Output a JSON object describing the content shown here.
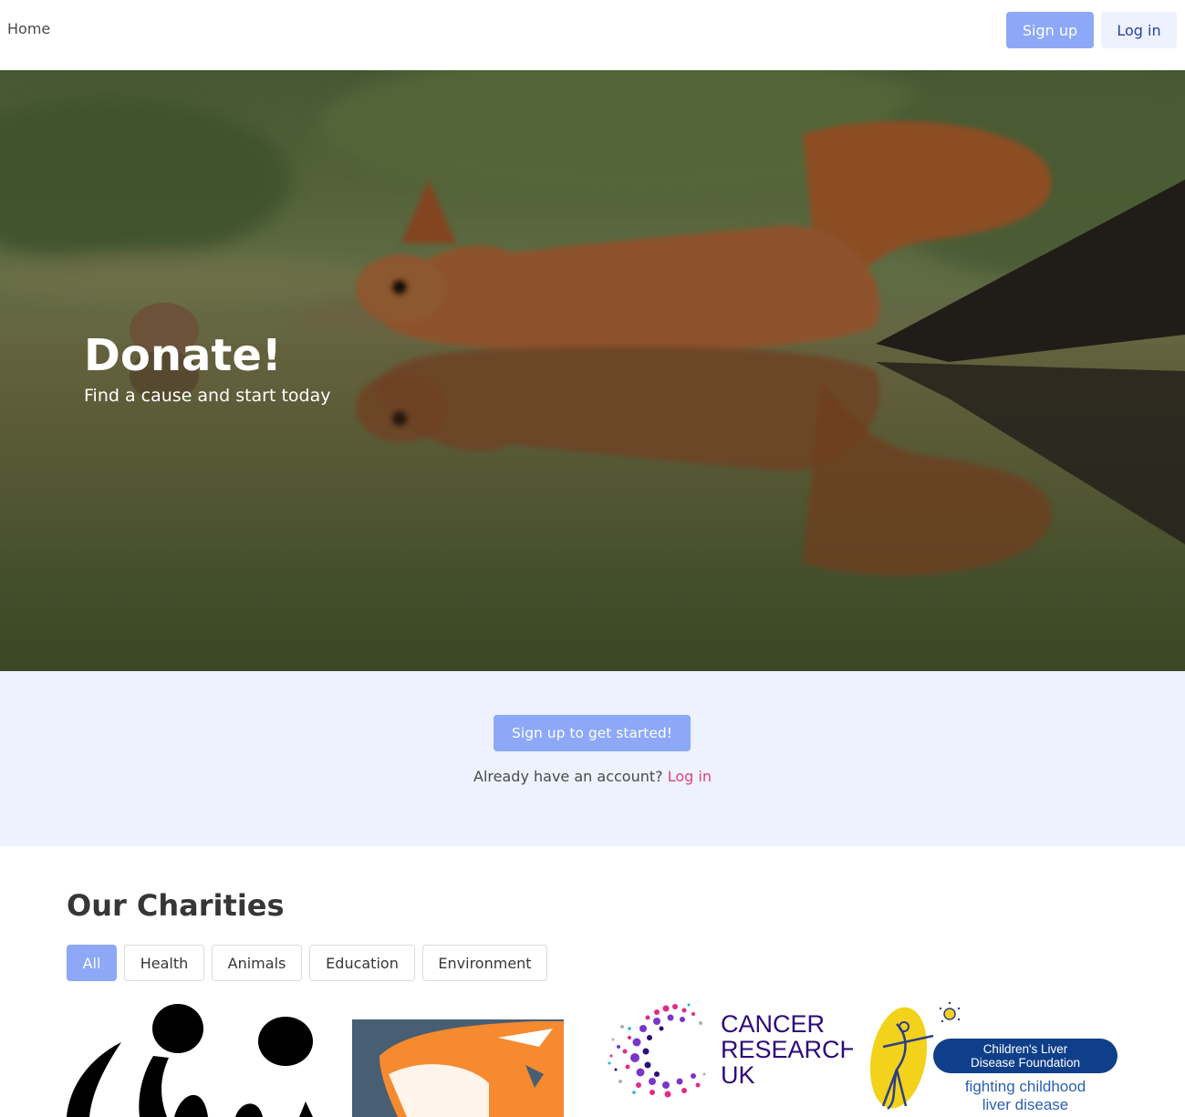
{
  "navbar": {
    "home_label": "Home",
    "signup_label": "Sign up",
    "login_label": "Log in"
  },
  "hero": {
    "title": "Donate!",
    "subtitle": "Find a cause and start today"
  },
  "cta": {
    "button_label": "Sign up to get started!",
    "prompt": "Already have an account?",
    "login_link": "Log in"
  },
  "charities": {
    "title": "Our Charities",
    "filters": [
      "All",
      "Health",
      "Animals",
      "Education",
      "Environment"
    ],
    "active_filter": "All",
    "logos": {
      "cancer_research": [
        "CANCER",
        "RESEARCH",
        "UK"
      ],
      "liver_foundation_name": [
        "Children's Liver",
        "Disease Foundation"
      ],
      "liver_foundation_tagline": [
        "fighting childhood",
        "liver disease"
      ]
    }
  },
  "colors": {
    "primary": "#8ca8f7",
    "light_bg": "#eef2fe",
    "link": "#e0447c",
    "cancer_purple": "#2e0a7a"
  }
}
